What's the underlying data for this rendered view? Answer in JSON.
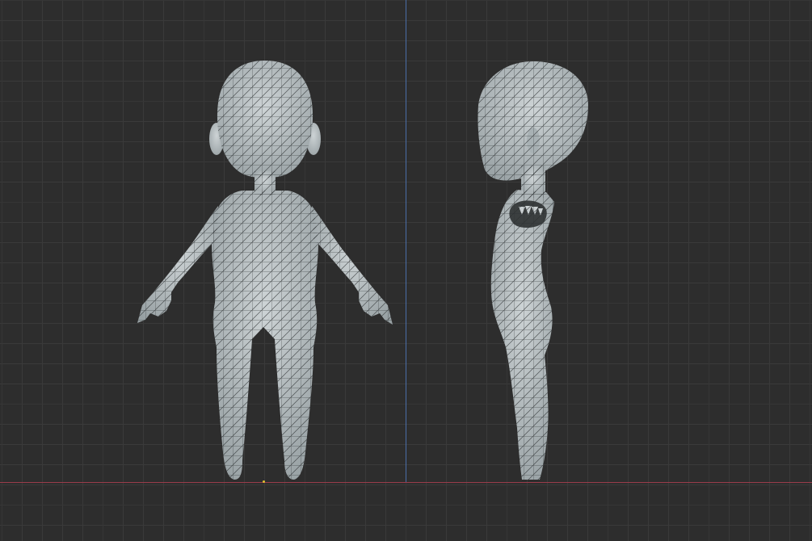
{
  "viewport": {
    "view": "orthographic-front-and-side",
    "background_color": "#2d2d2d",
    "grid_color": "#3a3a3a",
    "x_axis_color": "#9a3c4a",
    "z_axis_color": "#4a6ea8",
    "mesh_fill": "#b8c0c3",
    "wire_color": "#2a2e30"
  },
  "objects": [
    {
      "name": "character-front-view",
      "shading": "wireframe-overlay"
    },
    {
      "name": "character-side-view",
      "shading": "wireframe-overlay"
    }
  ]
}
